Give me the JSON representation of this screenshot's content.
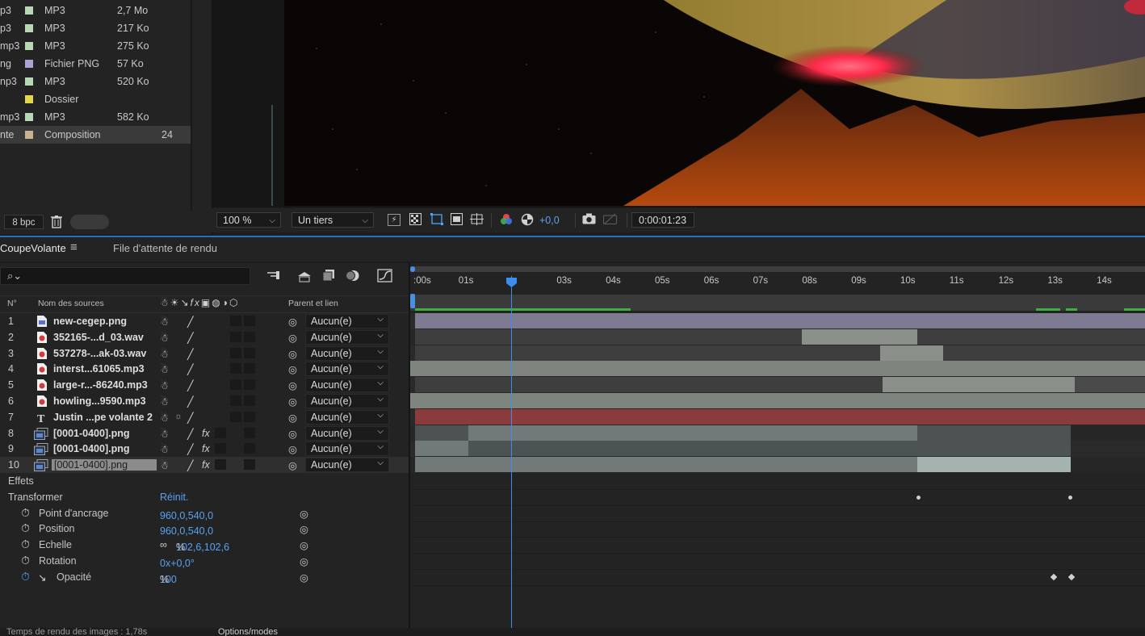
{
  "project": {
    "items": [
      {
        "ext": "p3",
        "type": "MP3",
        "size": "2,7 Mo",
        "swatch": "#b6d8b3"
      },
      {
        "ext": "p3",
        "type": "MP3",
        "size": "217 Ko",
        "swatch": "#b6d8b3"
      },
      {
        "ext": "mp3",
        "type": "MP3",
        "size": "275 Ko",
        "swatch": "#b6d8b3"
      },
      {
        "ext": "ng",
        "type": "Fichier PNG",
        "size": "57 Ko",
        "swatch": "#a9a3d6"
      },
      {
        "ext": "np3",
        "type": "MP3",
        "size": "520 Ko",
        "swatch": "#b6d8b3"
      },
      {
        "ext": "",
        "type": "Dossier",
        "size": "",
        "swatch": "#e3d64a"
      },
      {
        "ext": "mp3",
        "type": "MP3",
        "size": "582 Ko",
        "swatch": "#b6d8b3"
      },
      {
        "ext": "nte",
        "type": "Composition",
        "size": "24",
        "swatch": "#c8b48f"
      }
    ],
    "bpc": "8 bpc"
  },
  "viewer_toolbar": {
    "zoom": "100 %",
    "resolution": "Un tiers",
    "exposure": "+0,0",
    "timecode": "0:00:01:23"
  },
  "timeline": {
    "tab_active": "CoupeVolante",
    "tab_other": "File d'attente de rendu",
    "search_placeholder": "",
    "col_num": "N°",
    "col_name": "Nom des sources",
    "col_parent": "Parent et lien",
    "ruler": [
      ":00s",
      "01s",
      "02s",
      "03s",
      "04s",
      "05s",
      "06s",
      "07s",
      "08s",
      "09s",
      "10s",
      "11s",
      "12s",
      "13s",
      "14s"
    ],
    "layers": [
      {
        "num": "1",
        "name": "new-cegep.png",
        "kind": "png",
        "parent": "Aucun(e)"
      },
      {
        "num": "2",
        "name": "352165-...d_03.wav",
        "kind": "audio",
        "parent": "Aucun(e)"
      },
      {
        "num": "3",
        "name": "537278-...ak-03.wav",
        "kind": "audio",
        "parent": "Aucun(e)"
      },
      {
        "num": "4",
        "name": "interst...61065.mp3",
        "kind": "audio",
        "parent": "Aucun(e)"
      },
      {
        "num": "5",
        "name": "large-r...-86240.mp3",
        "kind": "audio",
        "parent": "Aucun(e)"
      },
      {
        "num": "6",
        "name": "howling...9590.mp3",
        "kind": "audio",
        "parent": "Aucun(e)"
      },
      {
        "num": "7",
        "name": "Justin ...pe volante 2",
        "kind": "text",
        "parent": "Aucun(e)"
      },
      {
        "num": "8",
        "name": "[0001-0400].png",
        "kind": "seq",
        "parent": "Aucun(e)"
      },
      {
        "num": "9",
        "name": "[0001-0400].png",
        "kind": "seq",
        "parent": "Aucun(e)"
      },
      {
        "num": "10",
        "name": "[0001-0400].png",
        "kind": "seq",
        "parent": "Aucun(e)"
      }
    ],
    "effects_label": "Effets",
    "transform_label": "Transformer",
    "reset_label": "Réinit.",
    "props": [
      {
        "name": "Point d'ancrage",
        "value": "960,0,540,0"
      },
      {
        "name": "Position",
        "value": "960,0,540,0"
      },
      {
        "name": "Echelle",
        "value": "102,6,102,6",
        "unit": "%"
      },
      {
        "name": "Rotation",
        "value": "0x+0,0°"
      },
      {
        "name": "Opacité",
        "value": "100",
        "unit": "%"
      }
    ],
    "current_time_seconds": 1.96,
    "status_left": "Temps de rendu des images : 1,78s",
    "status_mid": "Options/modes"
  }
}
